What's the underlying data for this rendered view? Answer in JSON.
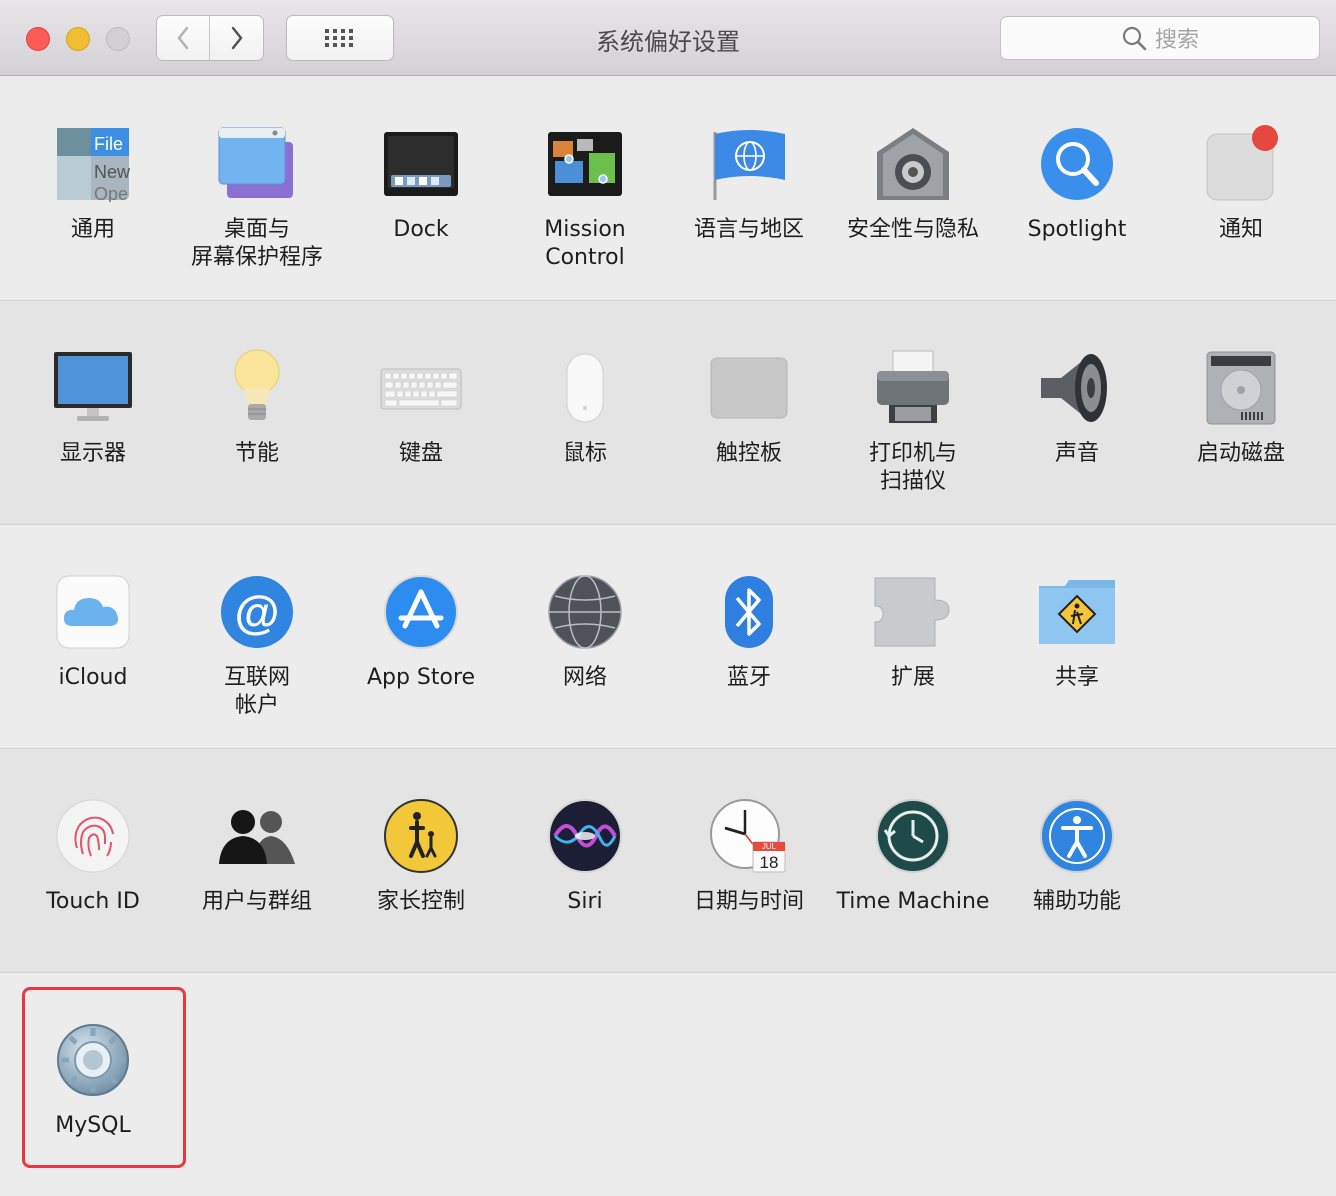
{
  "window": {
    "title": "系统偏好设置",
    "search_placeholder": "搜索",
    "icons": {
      "close": "close-light",
      "minimize": "minimize-light",
      "zoom": "zoom-light",
      "back": "chevron-left-icon",
      "forward": "chevron-right-icon",
      "grid": "grid-icon",
      "search": "search-icon"
    }
  },
  "rows": [
    {
      "panes": [
        {
          "label": "通用",
          "icon": "general-icon"
        },
        {
          "label": "桌面与\n屏幕保护程序",
          "icon": "desktop-screensaver-icon"
        },
        {
          "label": "Dock",
          "icon": "dock-icon"
        },
        {
          "label": "Mission\nControl",
          "icon": "mission-control-icon"
        },
        {
          "label": "语言与地区",
          "icon": "language-region-icon"
        },
        {
          "label": "安全性与隐私",
          "icon": "security-privacy-icon"
        },
        {
          "label": "Spotlight",
          "icon": "spotlight-icon"
        },
        {
          "label": "通知",
          "icon": "notifications-icon"
        }
      ]
    },
    {
      "panes": [
        {
          "label": "显示器",
          "icon": "displays-icon"
        },
        {
          "label": "节能",
          "icon": "energy-saver-icon"
        },
        {
          "label": "键盘",
          "icon": "keyboard-icon"
        },
        {
          "label": "鼠标",
          "icon": "mouse-icon"
        },
        {
          "label": "触控板",
          "icon": "trackpad-icon"
        },
        {
          "label": "打印机与\n扫描仪",
          "icon": "printers-scanners-icon"
        },
        {
          "label": "声音",
          "icon": "sound-icon"
        },
        {
          "label": "启动磁盘",
          "icon": "startup-disk-icon"
        }
      ]
    },
    {
      "panes": [
        {
          "label": "iCloud",
          "icon": "icloud-icon"
        },
        {
          "label": "互联网\n帐户",
          "icon": "internet-accounts-icon"
        },
        {
          "label": "App Store",
          "icon": "app-store-icon"
        },
        {
          "label": "网络",
          "icon": "network-icon"
        },
        {
          "label": "蓝牙",
          "icon": "bluetooth-icon"
        },
        {
          "label": "扩展",
          "icon": "extensions-icon"
        },
        {
          "label": "共享",
          "icon": "sharing-icon"
        }
      ]
    },
    {
      "panes": [
        {
          "label": "Touch ID",
          "icon": "touch-id-icon"
        },
        {
          "label": "用户与群组",
          "icon": "users-groups-icon"
        },
        {
          "label": "家长控制",
          "icon": "parental-controls-icon"
        },
        {
          "label": "Siri",
          "icon": "siri-icon"
        },
        {
          "label": "日期与时间",
          "icon": "date-time-icon",
          "calendar_month": "JUL",
          "calendar_day": "18"
        },
        {
          "label": "Time Machine",
          "icon": "time-machine-icon"
        },
        {
          "label": "辅助功能",
          "icon": "accessibility-icon"
        }
      ]
    },
    {
      "panes": [
        {
          "label": "MySQL",
          "icon": "mysql-icon",
          "highlighted": true
        }
      ]
    }
  ],
  "general_icon_text": [
    "File",
    "New",
    "Ope"
  ],
  "colors": {
    "highlight_border": "#e8393f",
    "notification_badge": "#e5463d"
  }
}
